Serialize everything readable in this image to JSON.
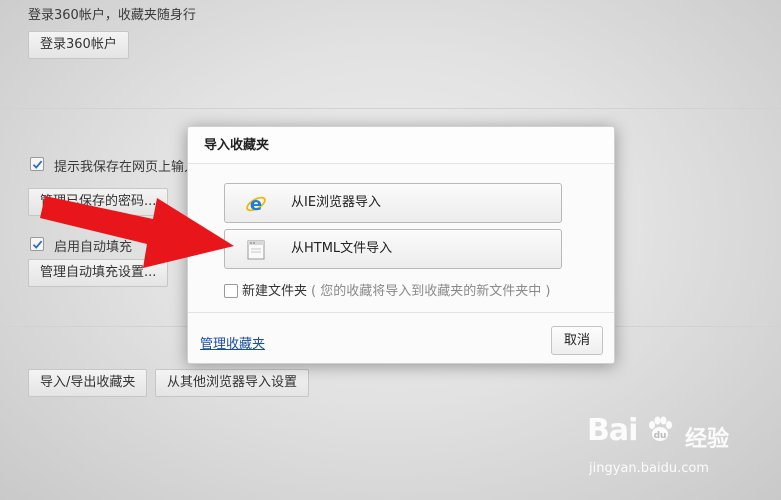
{
  "background": {
    "login_text": "登录360帐户，收藏夹随身行",
    "login_button": "登录360帐户",
    "remember_password_label": "提示我保存在网页上输入",
    "remember_password_checked": true,
    "manage_passwords_button": "管理已保存的密码...",
    "autofill_label": "启用自动填充",
    "autofill_checked": true,
    "manage_autofill_button": "管理自动填充设置...",
    "import_export_button": "导入/导出收藏夹",
    "import_other_button": "从其他浏览器导入设置"
  },
  "dialog": {
    "title": "导入收藏夹",
    "import_ie_label": "从IE浏览器导入",
    "import_html_label": "从HTML文件导入",
    "new_folder_label": "新建文件夹",
    "new_folder_hint": "( 您的收藏将导入到收藏夹的新文件夹中 )",
    "new_folder_checked": false,
    "manage_link": "管理收藏夹",
    "cancel_button": "取消"
  },
  "watermark": {
    "brand": "Bai",
    "brand_cn": "经验",
    "url": "jingyan.baidu.com"
  },
  "colors": {
    "arrow": "#e8151b",
    "link": "#1a4ea0",
    "ie_blue": "#1b7fd8",
    "ie_ring": "#f5b800"
  }
}
